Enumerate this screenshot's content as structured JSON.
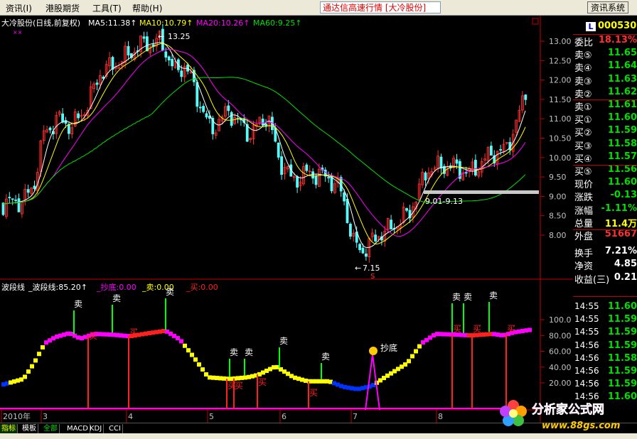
{
  "menu": [
    "资讯(I)",
    "港股期货",
    "工具(T)",
    "帮助(H)"
  ],
  "marquee": "通达信高速行情 [大冷股份]",
  "system_button": "资讯系统",
  "chart_header": {
    "title": "大冷股份(日线,前复权)",
    "ma5": "MA5:11.38↑",
    "ma10": "MA10:10.79↑",
    "ma20": "MA20:10.26↑",
    "ma60": "MA60:9.25↑"
  },
  "annotations": {
    "high": "13.25",
    "low": "7.15",
    "range": "9.01-9.13",
    "s_marker": "S",
    "xx": "××"
  },
  "indicator_header": {
    "name": "波段线",
    "value": "_波段线:85.20↑",
    "chaodi": "_抄底:0.00",
    "mai_sell": "_卖:0.00",
    "mai_buy": "_买:0.00"
  },
  "labels": {
    "sell": "卖",
    "buy": "买",
    "chaodi": "抄底"
  },
  "price_axis": [
    "13.00",
    "12.50",
    "12.00",
    "11.50",
    "11.00",
    "10.50",
    "10.00",
    "9.50",
    "9.00",
    "8.50",
    "8.00"
  ],
  "ind_axis": [
    "100.0",
    "80.00",
    "60.00",
    "40.00",
    "20.00"
  ],
  "time_axis": [
    "2010年",
    "3",
    "4",
    "5",
    "6",
    "7",
    "8"
  ],
  "bottom_tabs": [
    "指标",
    "模板",
    "全部",
    "MACD",
    "KDJ",
    "CCI"
  ],
  "right_panel": {
    "code": "000530",
    "badge": "L",
    "rows": [
      {
        "label": "委比",
        "value": "18.13%",
        "color": "#ff3030"
      },
      {
        "label": "卖⑤",
        "value": "11.65",
        "color": "#00e000"
      },
      {
        "label": "卖④",
        "value": "11.64",
        "color": "#00e000"
      },
      {
        "label": "卖③",
        "value": "11.63",
        "color": "#00e000"
      },
      {
        "label": "卖②",
        "value": "11.62",
        "color": "#00e000"
      },
      {
        "label": "卖①",
        "value": "11.61",
        "color": "#00e000"
      },
      {
        "label": "买①",
        "value": "11.60",
        "color": "#00e000"
      },
      {
        "label": "买②",
        "value": "11.59",
        "color": "#00e000"
      },
      {
        "label": "买③",
        "value": "11.58",
        "color": "#00e000"
      },
      {
        "label": "买④",
        "value": "11.57",
        "color": "#00e000"
      },
      {
        "label": "买⑤",
        "value": "11.56",
        "color": "#00e000"
      },
      {
        "label": "现价",
        "value": "11.60",
        "color": "#00e000"
      },
      {
        "label": "涨跌",
        "value": "-0.13",
        "color": "#00e000"
      },
      {
        "label": "涨幅",
        "value": "-1.11%",
        "color": "#00e000"
      },
      {
        "label": "总量",
        "value": "11.4万",
        "color": "#ffff00"
      },
      {
        "label": "外盘",
        "value": "51667",
        "color": "#ff3030"
      },
      {
        "label": "换手",
        "value": "7.21%",
        "color": "#ffffff"
      },
      {
        "label": "净资",
        "value": "4.85",
        "color": "#ffffff"
      },
      {
        "label": "收益(三)",
        "value": "0.21",
        "color": "#ffffff"
      }
    ],
    "ticks": [
      {
        "time": "14:55",
        "price": "11.60"
      },
      {
        "time": "14:55",
        "price": "11.59"
      },
      {
        "time": "14:55",
        "price": "11.59"
      },
      {
        "time": "14:56",
        "price": "11.59"
      },
      {
        "time": "14:56",
        "price": "11.58"
      },
      {
        "time": "14:56",
        "price": "11.59"
      },
      {
        "time": "14:56",
        "price": "11.59"
      },
      {
        "time": "14:56",
        "price": "11.60"
      }
    ]
  },
  "watermark": {
    "text": "分析家公式网",
    "url": "www.88gs.com"
  },
  "colors": {
    "up": "#ff3030",
    "down": "#54fcfc",
    "ma5": "#ffffff",
    "ma10": "#ffff00",
    "ma20": "#ff00ff",
    "ma60": "#00e000",
    "axis": "#c00000",
    "wave_magenta": "#ff00ff",
    "wave_yellow": "#ffff00",
    "wave_blue": "#0033ff",
    "wave_red": "#ff2020",
    "sell_signal": "#00ff00",
    "buy_signal": "#ff2020"
  }
}
